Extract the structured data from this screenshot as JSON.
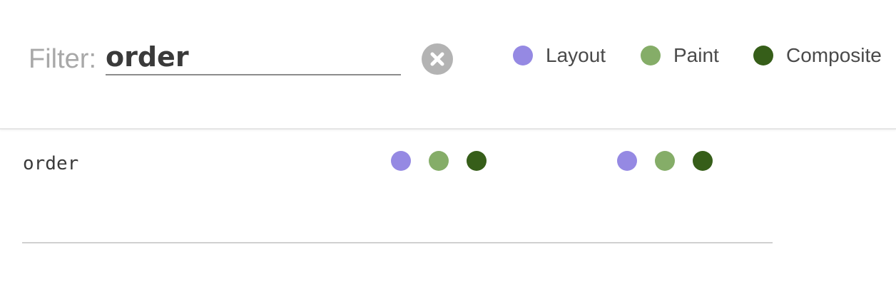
{
  "filter": {
    "label": "Filter:",
    "value": "order"
  },
  "legend": [
    {
      "label": "Layout",
      "color": "#9589e3"
    },
    {
      "label": "Paint",
      "color": "#85ad68"
    },
    {
      "label": "Composite",
      "color": "#365e19"
    }
  ],
  "rows": [
    {
      "name": "order",
      "group_a": {
        "layout": true,
        "paint": true,
        "composite": true
      },
      "group_b": {
        "layout": true,
        "paint": true,
        "composite": true
      }
    }
  ],
  "icons": {
    "clear": "close-circle-icon"
  }
}
